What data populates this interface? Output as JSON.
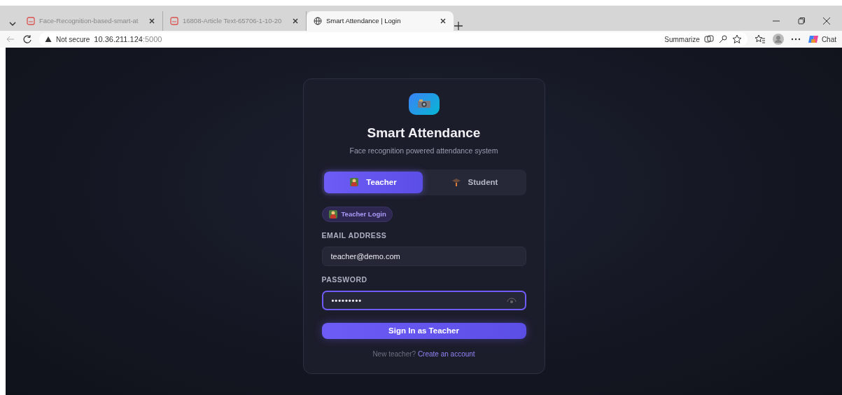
{
  "browser": {
    "tabs": [
      {
        "title": "Face-Recognition-based-smart-at",
        "kind": "pdf",
        "selected": false
      },
      {
        "title": "16808-Article Text-65706-1-10-20",
        "kind": "pdf",
        "selected": false
      },
      {
        "title": "Smart Attendance | Login",
        "kind": "web",
        "selected": true
      }
    ],
    "address": {
      "security": "Not secure",
      "host": "10.36.211.124",
      "port": ":5000"
    },
    "summarize": "Summarize",
    "chat": "Chat"
  },
  "login": {
    "title": "Smart Attendance",
    "subtitle": "Face recognition powered attendance system",
    "roles": [
      {
        "label": "Teacher",
        "selected": true
      },
      {
        "label": "Student",
        "selected": false
      }
    ],
    "badge": "Teacher Login",
    "fields": [
      {
        "label": "EMAIL ADDRESS",
        "value": "teacher@demo.com",
        "kind": "text",
        "focused": false
      },
      {
        "label": "PASSWORD",
        "value": "•••••••••",
        "kind": "password",
        "focused": true
      }
    ],
    "submit": "Sign In as Teacher",
    "footer": {
      "text": "New teacher?",
      "link": "Create an account"
    }
  }
}
